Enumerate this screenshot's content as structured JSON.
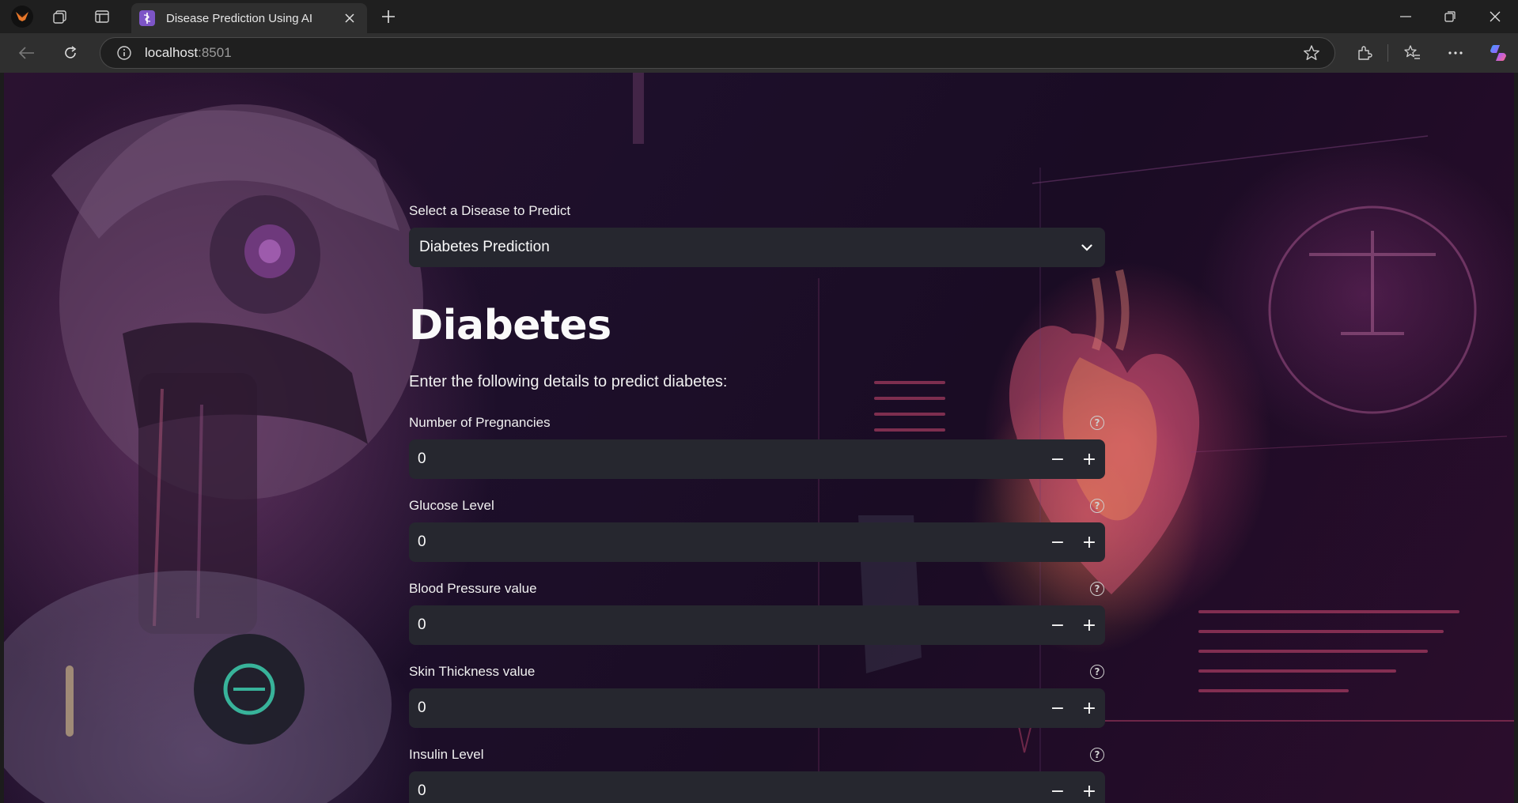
{
  "browser": {
    "tab_title": "Disease Prediction Using AI",
    "url_host": "localhost",
    "url_port": ":8501",
    "icons": [
      "profile-icon",
      "workspaces-icon",
      "vertical-tabs-icon",
      "new-tab-icon",
      "minimize-icon",
      "restore-icon",
      "close-icon",
      "back-icon",
      "refresh-icon",
      "site-info-icon",
      "favorite-star-icon",
      "extensions-icon",
      "favorites-icon",
      "more-icon",
      "copilot-icon"
    ]
  },
  "page": {
    "select_label": "Select a Disease to Predict",
    "select_value": "Diabetes Prediction",
    "heading": "Diabetes",
    "subtext": "Enter the following details to predict diabetes:",
    "fields": [
      {
        "label": "Number of Pregnancies",
        "value": "0"
      },
      {
        "label": "Glucose Level",
        "value": "0"
      },
      {
        "label": "Blood Pressure value",
        "value": "0"
      },
      {
        "label": "Skin Thickness value",
        "value": "0"
      },
      {
        "label": "Insulin Level",
        "value": "0"
      }
    ],
    "help_glyph": "?",
    "minus_glyph": "−",
    "plus_glyph": "+"
  },
  "colors": {
    "input_bg": "#26272f",
    "chrome_bg": "#1f1f1f",
    "toolbar_bg": "#2f2f2f",
    "accent": "#7d55c7"
  }
}
